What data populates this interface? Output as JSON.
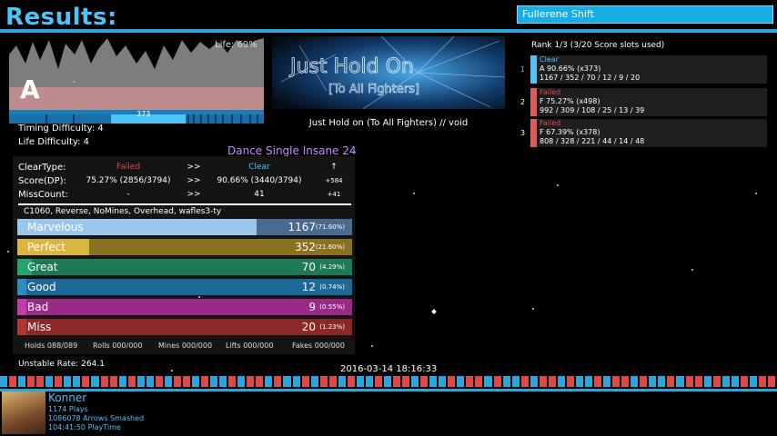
{
  "header": {
    "title": "Results:",
    "theme_name": "Fullerene Shift"
  },
  "graph": {
    "grade": "A",
    "life_label": "Life: 69%",
    "combo_value": "373"
  },
  "song": {
    "banner_line1": "Just Hold On",
    "banner_line2": "[To All Fighters]",
    "title": "Just Hold on (To All Fighters) // void"
  },
  "difficulty": {
    "timing": "Timing Difficulty: 4",
    "life": "Life Difficulty: 4",
    "chart": "Dance Single Insane 24"
  },
  "stats": {
    "rows": [
      {
        "label": "ClearType:",
        "old": "Failed",
        "arrow": ">>",
        "new": "Clear",
        "delta": "↑"
      },
      {
        "label": "Score(DP):",
        "old": "75.27% (2856/3794)",
        "arrow": ">>",
        "new": "90.66% (3440/3794)",
        "delta": "+584"
      },
      {
        "label": "MissCount:",
        "old": "-",
        "arrow": ">>",
        "new": "41",
        "delta": "+41"
      }
    ],
    "mods": "C1060, Reverse, NoMines, Overhead, wafles3-ty"
  },
  "judgments": [
    {
      "name": "Marvelous",
      "count": "1167",
      "pct": "(71.60%)",
      "fraction": 0.716,
      "color": "#9cc7ec",
      "dark": "#4a6b8f",
      "pct_color": "#fff"
    },
    {
      "name": "Perfect",
      "count": "352",
      "pct": "(21.60%)",
      "fraction": 0.216,
      "color": "#d9b641",
      "dark": "#8a7220",
      "pct_color": "#fff"
    },
    {
      "name": "Great",
      "count": "70",
      "pct": "(4.29%)",
      "fraction": 0.043,
      "color": "#22a66b",
      "dark": "#1d7a52",
      "pct_color": "#fff"
    },
    {
      "name": "Good",
      "count": "12",
      "pct": "(0.74%)",
      "fraction": 0.0074,
      "color": "#2a8ec2",
      "dark": "#1d6a98",
      "pct_color": "#fff"
    },
    {
      "name": "Bad",
      "count": "9",
      "pct": "(0.55%)",
      "fraction": 0.0055,
      "color": "#c23ba7",
      "dark": "#9a2a88",
      "pct_color": "#fff"
    },
    {
      "name": "Miss",
      "count": "20",
      "pct": "(1.23%)",
      "fraction": 0.0123,
      "color": "#b33636",
      "dark": "#8e2828",
      "pct_color": "#fff"
    }
  ],
  "footer_counts": {
    "holds": "Holds 088/089",
    "rolls": "Rolls 000/000",
    "mines": "Mines 000/000",
    "lifts": "Lifts 000/000",
    "fakes": "Fakes 000/000"
  },
  "unstable_rate": "Unstable Rate: 264.1",
  "date": "2016-03-14 18:16:33",
  "ranking": {
    "header": "Rank 1/3 (3/20 Score slots used)",
    "entries": [
      {
        "num": "1",
        "status": "Clear",
        "status_color": "#4fc3f7",
        "bar_color": "#4fc3f7",
        "line2": "A 90.66% (x373)",
        "line3": "1167 / 352 / 70 / 12 / 9 / 20"
      },
      {
        "num": "2",
        "status": "Failed",
        "status_color": "#e04848",
        "bar_color": "#e05a5a",
        "line2": "F 75.27% (x498)",
        "line3": "992 / 309 / 108 / 25 / 13 / 39"
      },
      {
        "num": "3",
        "status": "Failed",
        "status_color": "#e04848",
        "bar_color": "#e05a5a",
        "line2": "F 67.39% (x378)",
        "line3": "808 / 328 / 221 / 44 / 14 / 48"
      }
    ]
  },
  "player": {
    "name": "Konner",
    "plays": "1174 Plays",
    "arrows": "1086078 Arrows Smashed",
    "playtime": "104:41:50 PlayTime"
  }
}
